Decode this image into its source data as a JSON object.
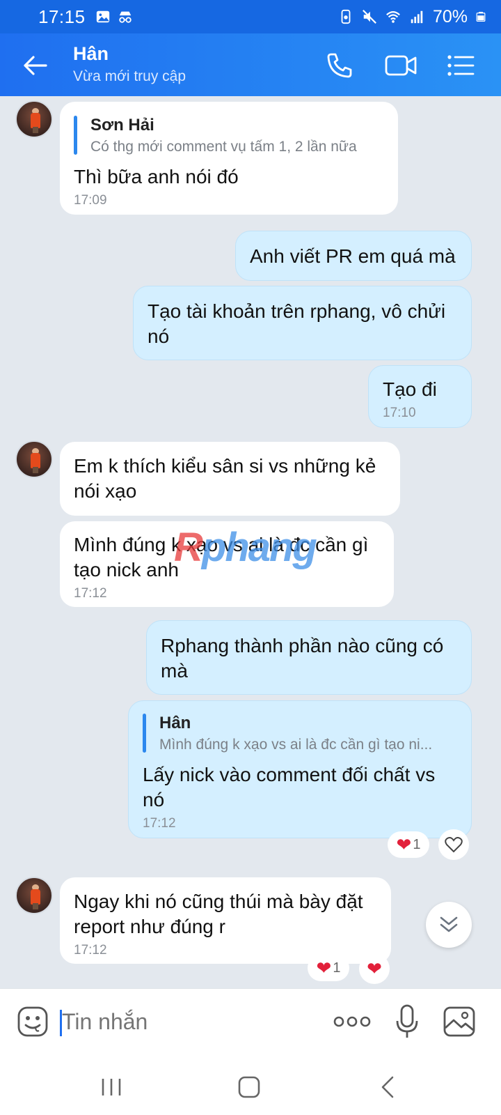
{
  "status_bar": {
    "time": "17:15",
    "battery": "70%"
  },
  "header": {
    "contact_name": "Hân",
    "contact_status": "Vừa mới truy cập"
  },
  "messages": [
    {
      "direction": "in",
      "reply_name": "Sơn Hải",
      "reply_text": "Có thg mới comment vụ tấm 1, 2 lần nữa",
      "text": "Thì bữa anh nói đó",
      "time": "17:09"
    },
    {
      "direction": "out",
      "text": "Anh viết PR em quá mà"
    },
    {
      "direction": "out",
      "text": "Tạo tài khoản trên rphang, vô chửi nó"
    },
    {
      "direction": "out",
      "text": "Tạo đi",
      "time": "17:10"
    },
    {
      "direction": "in",
      "text": "Em k thích kiểu sân si vs những kẻ nói xạo"
    },
    {
      "direction": "in",
      "text": "Mình đúng k xạo vs ai là đc cần gì tạo nick anh",
      "time": "17:12"
    },
    {
      "direction": "out",
      "text": "Rphang thành phần nào cũng có mà"
    },
    {
      "direction": "out",
      "reply_name": "Hân",
      "reply_text": "Mình đúng k xạo vs ai là đc cần gì tạo ni...",
      "text": "Lấy nick vào comment đối chất vs nó",
      "time": "17:12"
    },
    {
      "direction": "in",
      "text": "Ngay khi nó cũng thúi mà bày đặt report như đúng r",
      "time": "17:12"
    }
  ],
  "reactions": {
    "msg8_count": "1",
    "msg9_count": "1"
  },
  "watermark": {
    "first": "R",
    "rest": "phang"
  },
  "input": {
    "placeholder": "Tin nhắn"
  },
  "icons": {
    "back": "back-arrow-icon",
    "call": "phone-icon",
    "video": "video-camera-icon",
    "menu": "list-menu-icon",
    "sticker": "sticker-face-icon",
    "more": "more-dots-icon",
    "mic": "microphone-icon",
    "image": "image-icon"
  },
  "colors": {
    "header": "#1f6ff0",
    "outgoing_bubble": "#d4efff",
    "incoming_bubble": "#ffffff",
    "background": "#e3e8ee",
    "reaction_heart": "#e2203a"
  }
}
